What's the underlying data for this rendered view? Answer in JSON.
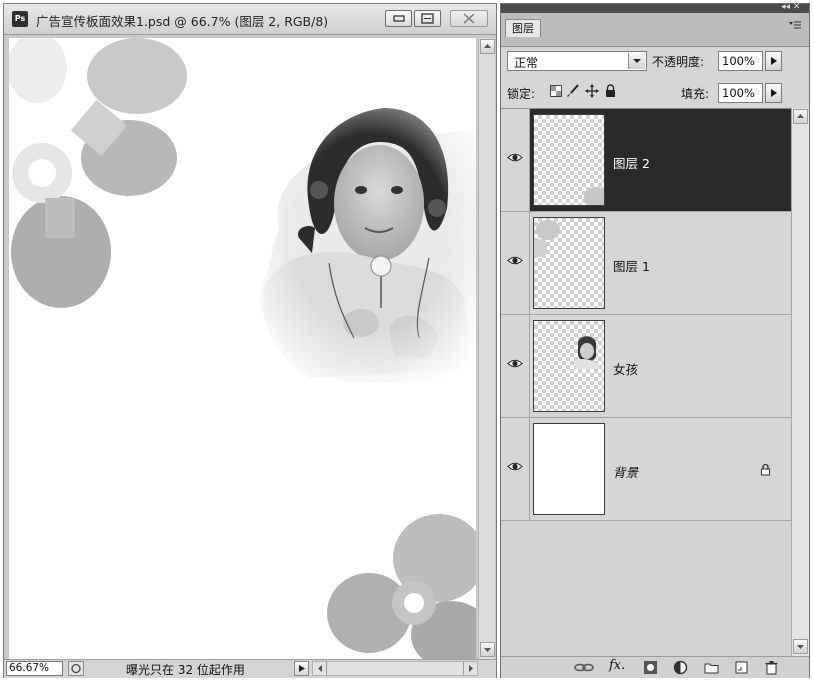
{
  "document": {
    "title": "广告宣传板面效果1.psd @ 66.7% (图层 2, RGB/8)",
    "app_icon": "Ps",
    "zoom": "66.67%",
    "status_text": "曝光只在 32 位起作用"
  },
  "layers_panel": {
    "tab_label": "图层",
    "collapse_glyph": "◂◂ ✕",
    "blend_mode": "正常",
    "opacity_label": "不透明度:",
    "opacity_value": "100%",
    "lock_label": "锁定:",
    "fill_label": "填充:",
    "fill_value": "100%",
    "layers": [
      {
        "name": "图层 2",
        "visible": true,
        "selected": true
      },
      {
        "name": "图层 1",
        "visible": true,
        "selected": false
      },
      {
        "name": "女孩",
        "visible": true,
        "selected": false
      },
      {
        "name": "背景",
        "visible": true,
        "selected": false,
        "locked": true
      }
    ],
    "bottom_icons": [
      "link-layers-icon",
      "fx-icon",
      "layer-mask-icon",
      "adjustment-layer-icon",
      "new-group-icon",
      "new-layer-icon",
      "delete-layer-icon"
    ],
    "fx_label": "fx."
  },
  "colors": {
    "selected_row": "#2a2a2a",
    "panel_bg": "#d6d6d6",
    "flower_gray": "#b3b3b3"
  }
}
